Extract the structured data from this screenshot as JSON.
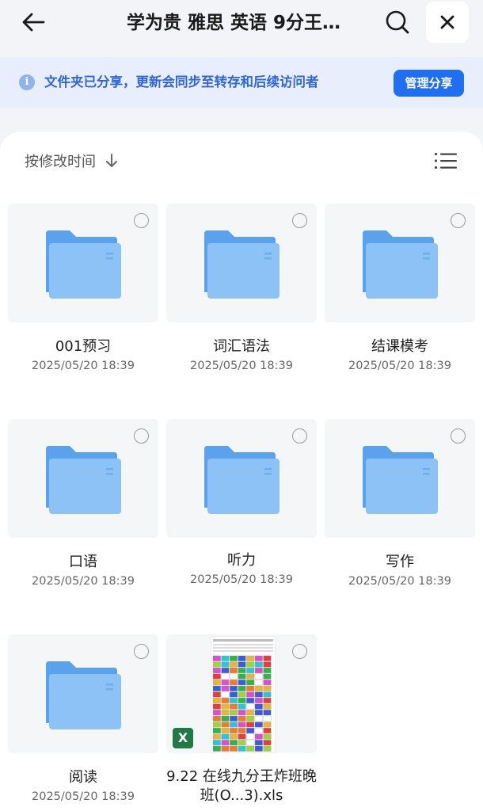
{
  "header": {
    "title": "学为贵 雅思 英语 9分王…",
    "back_icon": "arrow-left-icon",
    "search_icon": "search-icon",
    "close_icon": "close-icon"
  },
  "banner": {
    "icon": "info-icon",
    "icon_glyph": "i",
    "text": "文件夹已分享，更新会同步至转存和后续访问者",
    "button_label": "管理分享",
    "accent": "#1f6ff2"
  },
  "toolbar": {
    "sort_label": "按修改时间",
    "sort_icon": "arrow-down-icon",
    "view_icon": "list-view-icon"
  },
  "items": [
    {
      "name": "001预习",
      "date": "2025/05/20 18:39",
      "kind": "folder"
    },
    {
      "name": "词汇语法",
      "date": "2025/05/20 18:39",
      "kind": "folder"
    },
    {
      "name": "结课模考",
      "date": "2025/05/20 18:39",
      "kind": "folder"
    },
    {
      "name": "口语",
      "date": "2025/05/20 18:39",
      "kind": "folder"
    },
    {
      "name": "听力",
      "date": "2025/05/20 18:39",
      "kind": "folder"
    },
    {
      "name": "写作",
      "date": "2025/05/20 18:39",
      "kind": "folder"
    },
    {
      "name": "阅读",
      "date": "2025/05/20 18:39",
      "kind": "folder"
    },
    {
      "name": "9.22   在线九分王炸班晚班(O...3).xls",
      "kind": "xls",
      "badge": "X"
    }
  ],
  "colors": {
    "folder_front": "#8cc2f5",
    "folder_back": "#5aa3ec",
    "banner_bg": "#e8eefb",
    "banner_text": "#2f66d9",
    "xls_green": "#1f7a46"
  }
}
